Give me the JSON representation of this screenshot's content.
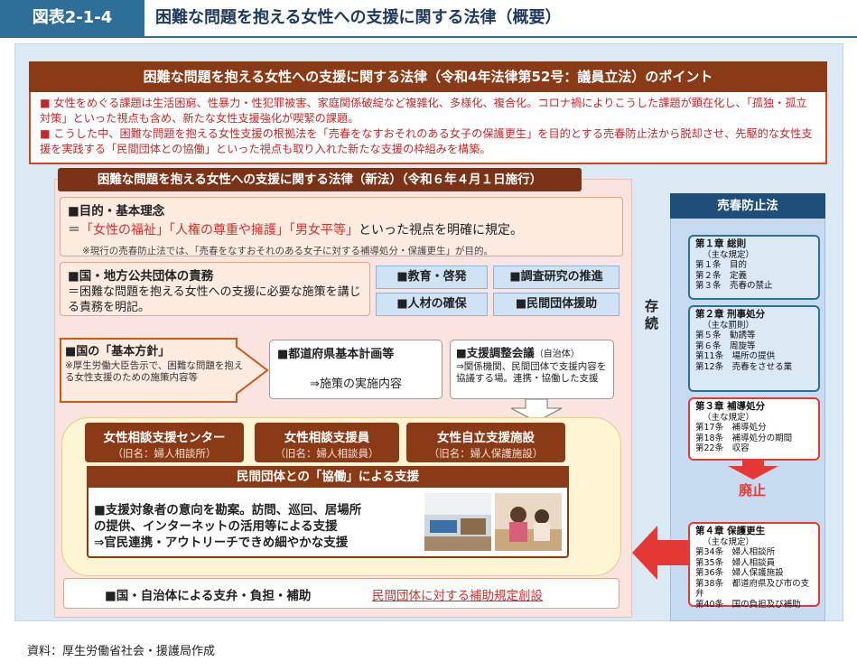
{
  "header": {
    "fig_num": "図表2-1-4",
    "fig_title": "困難な問題を抱える女性への支援に関する法律（概要）"
  },
  "banner": "困難な問題を抱える女性への支援に関する法律（令和4年法律第52号：議員立法）のポイント",
  "intro": [
    "■ 女性をめぐる課題は生活困窮、性暴力・性犯罪被害、家庭関係破綻など複雑化、多様化、複合化。コロナ禍によりこうした課題が顕在化し、「孤独・孤立対策」といった視点も含め、新たな女性支援強化が喫緊の課題。",
    "■ こうした中、困難な問題を抱える女性支援の根拠法を「売春をなすおそれのある女子の保護更生」を目的とする売春防止法から脱却させ、先駆的な女性支援を実践する「民間団体との協働」といった視点も取り入れた新たな支援の枠組みを構築。"
  ],
  "new_law": {
    "title": "困難な問題を抱える女性への支援に関する法律（新法）（令和６年４月１日施行）",
    "purpose": {
      "head": "■目的・基本理念",
      "prefix": "＝",
      "k1": "「女性の福祉」",
      "k2": "「人権の尊重や擁護」",
      "k3": "「男女平等」",
      "suffix": "といった視点を明確に規定。",
      "note": "※現行の売春防止法では、「売春をなすおそれのある女子に対する補導処分・保護更生」が目的。"
    },
    "responsibility": {
      "head": "■国・地方公共団体の責務",
      "body": "＝困難な問題を抱える女性への支援に必要な施策を講じる責務を明記。"
    },
    "tags": [
      "■教育・啓発",
      "■調査研究の推進",
      "■人材の確保",
      "■民間団体援助"
    ],
    "policy": {
      "head": "■国の「基本方針」",
      "note": "※厚生労働大臣告示で、困難な問題を抱える女性支援のための施策内容等"
    },
    "pref_plan": {
      "head": "■都道府県基本計画等",
      "body": "⇒施策の実施内容"
    },
    "council": {
      "head": "■支援調整会議",
      "small": "（自治体）",
      "body": "⇒関係機関、民間団体で支援内容を協議する場。連携・協働した支援"
    },
    "facilities": [
      {
        "name": "女性相談支援センター",
        "old": "（旧名：婦人相談所）"
      },
      {
        "name": "女性相談支援員",
        "old": "（旧名：婦人相談員）"
      },
      {
        "name": "女性自立支援施設",
        "old": "（旧名：婦人保護施設）"
      }
    ],
    "collab": {
      "title": "民間団体との「協働」による支援",
      "l1": "■支援対象者の意向を勘案。訪問、巡回、居場所",
      "l2": "の提供、インターネットの活用等による支援",
      "l3": "⇒官民連携・アウトリーチできめ細やかな支援"
    },
    "finance": {
      "left": "■国・自治体による支弁・負担・補助",
      "right": "民間団体に対する補助規定創設"
    }
  },
  "act": {
    "title": "売春防止法",
    "continue": "存続",
    "abolish": "廃止",
    "chapters": [
      {
        "title": "第１章 総則",
        "sub": "（主な規定）",
        "items": [
          "第１条　目的",
          "第２条　定義",
          "第３条　売春の禁止"
        ]
      },
      {
        "title": "第２章 刑事処分",
        "sub": "（主な罰則）",
        "items": [
          "第５条　勧誘等",
          "第６条　周旋等",
          "第11条　場所の提供",
          "第12条　売春をさせる業"
        ]
      },
      {
        "title": "第３章 補導処分",
        "sub": "（主な規定）",
        "items": [
          "第17条　補導処分",
          "第18条　補導処分の期間",
          "第22条　収容"
        ]
      },
      {
        "title": "第４章 保護更生",
        "sub": "（主な規定）",
        "items": [
          "第34条　婦人相談所",
          "第35条　婦人相談員",
          "第36条　婦人保護施設",
          "第38条　都道府県及び市の支弁",
          "第40条　国の負担及び補助"
        ]
      }
    ]
  },
  "source": "資料：厚生労働省社会・援護局作成",
  "colors": {
    "accent_blue": "#2e6f9a",
    "brown": "#8a3a14",
    "red": "#d32f2f"
  }
}
